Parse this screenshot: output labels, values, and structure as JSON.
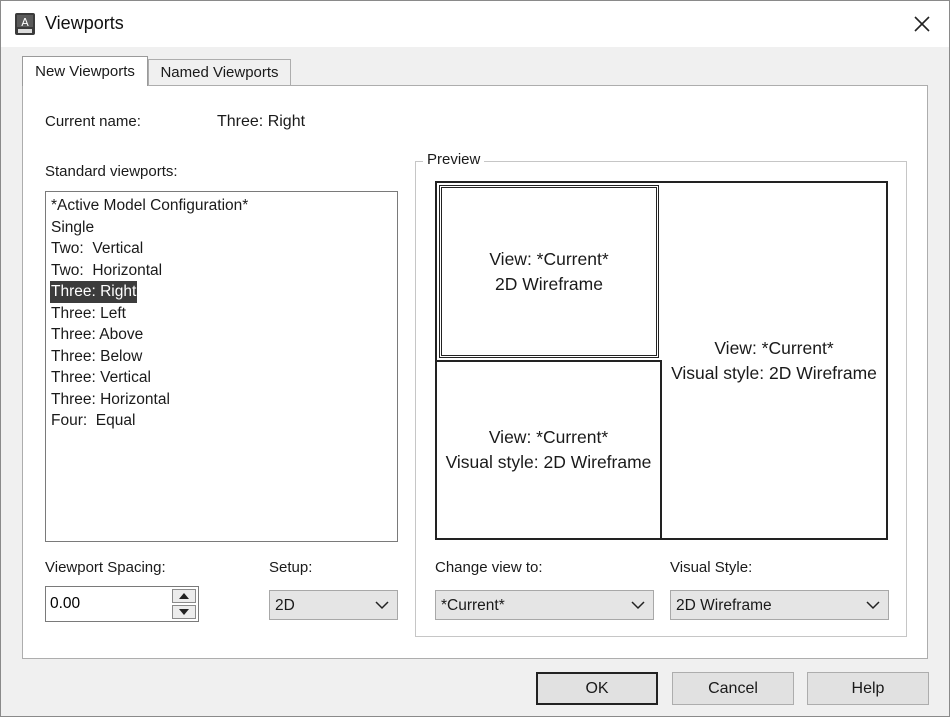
{
  "window": {
    "title": "Viewports"
  },
  "tabs": [
    {
      "label": "New Viewports",
      "active": true
    },
    {
      "label": "Named Viewports",
      "active": false
    }
  ],
  "current_name": {
    "label": "Current name:",
    "value": "Three: Right"
  },
  "standard_viewports": {
    "label": "Standard viewports:",
    "items": [
      "*Active Model Configuration*",
      "Single",
      "Two:  Vertical",
      "Two:  Horizontal",
      "Three: Right",
      "Three: Left",
      "Three: Above",
      "Three: Below",
      "Three: Vertical",
      "Three: Horizontal",
      "Four:  Equal"
    ],
    "selected": "Three: Right"
  },
  "preview": {
    "legend": "Preview",
    "viewports": [
      {
        "line1": "View: *Current*",
        "line2": "2D Wireframe",
        "active": true
      },
      {
        "line1": "View: *Current*",
        "line2": "Visual style: 2D Wireframe",
        "active": false
      },
      {
        "line1": "View: *Current*",
        "line2": "Visual style: 2D Wireframe",
        "active": false
      }
    ]
  },
  "viewport_spacing": {
    "label": "Viewport Spacing:",
    "value": "0.00"
  },
  "setup": {
    "label": "Setup:",
    "value": "2D"
  },
  "change_view_to": {
    "label": "Change view to:",
    "value": "*Current*"
  },
  "visual_style": {
    "label": "Visual Style:",
    "value": "2D Wireframe"
  },
  "buttons": {
    "ok": "OK",
    "cancel": "Cancel",
    "help": "Help"
  },
  "icons": {
    "app": "autocad-app-icon",
    "close": "close-icon",
    "spin_up": "arrow-up-icon",
    "spin_down": "arrow-down-icon",
    "dropdown": "chevron-down-icon"
  },
  "colors": {
    "selection": "#3c3c3c",
    "dialog_bg": "#f0f0f0",
    "panel_bg": "#ffffff"
  }
}
